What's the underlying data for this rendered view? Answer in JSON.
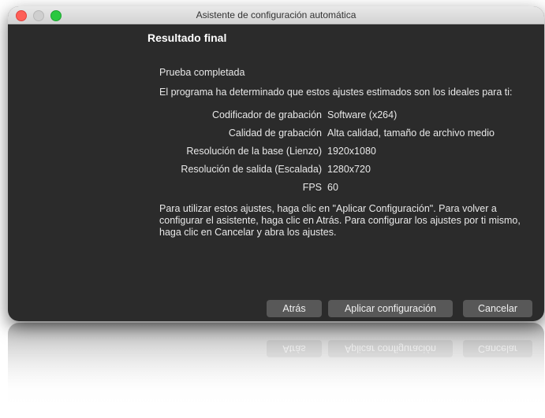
{
  "window": {
    "title": "Asistente de configuración automática"
  },
  "page": {
    "heading": "Resultado final",
    "status": "Prueba completada",
    "intro": "El programa ha determinado que estos ajustes estimados son los ideales para ti:",
    "settings": [
      {
        "label": "Codificador de grabación",
        "value": "Software (x264)"
      },
      {
        "label": "Calidad de grabación",
        "value": "Alta calidad, tamaño de archivo medio"
      },
      {
        "label": "Resolución de la base (Lienzo)",
        "value": "1920x1080"
      },
      {
        "label": "Resolución de salida (Escalada)",
        "value": "1280x720"
      },
      {
        "label": "FPS",
        "value": "60"
      }
    ],
    "instructions": "Para utilizar estos ajustes, haga clic en \"Aplicar Configuración\". Para volver a configurar el asistente, haga clic en Atrás. Para configurar los ajustes por ti mismo, haga clic en Cancelar y abra los ajustes."
  },
  "buttons": {
    "back": "Atrás",
    "apply": "Aplicar configuración",
    "cancel": "Cancelar"
  },
  "colors": {
    "window_bg": "#2b2b2b",
    "button_bg": "#585858",
    "close": "#fe5f57",
    "zoom": "#2ac840"
  }
}
